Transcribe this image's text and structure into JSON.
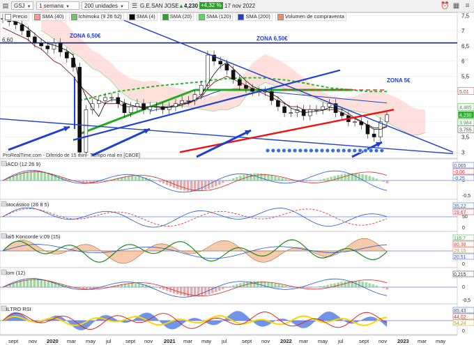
{
  "toolbar": {
    "symbol": "GSJ",
    "period": "1 semana",
    "units": "200 unidades",
    "instrument": "G.E.SAN JOSE",
    "last": "4,230",
    "change": "+4,32 %",
    "date": "17 nov 2022"
  },
  "legend": [
    {
      "label": "Precio",
      "color": "#ffffff"
    },
    {
      "label": "SMA (40)",
      "color": "#ff9999"
    },
    {
      "label": "Ichimoku (9 26 52)",
      "color": "#66cc66"
    },
    {
      "label": "SMA (4)",
      "color": "#000000"
    },
    {
      "label": "SMA (20)",
      "color": "#22aa22"
    },
    {
      "label": "SMA (120)",
      "color": "#55dd55"
    },
    {
      "label": "SMA (200)",
      "color": "#1f3fd0"
    },
    {
      "label": "Volumen de compraventa",
      "color": "#ff8c5a"
    }
  ],
  "annotations": {
    "zona_left": "ZONA 6,50€",
    "zona_right": "ZONA 6,50€",
    "zona_5": "ZONA 5€",
    "level_label": "6,60",
    "source": "ProRealTime.com - Diferido de 15 min - Tiempo real en [CBOE]"
  },
  "price_labels": [
    {
      "text": "5,01",
      "value": 5.01,
      "bg": "#ffffff",
      "fg": "#dd2222"
    },
    {
      "text": "4,485",
      "value": 4.485,
      "bg": "#ffffff",
      "fg": "#22aa22"
    },
    {
      "text": "4,230",
      "value": 4.23,
      "bg": "#33aa33",
      "fg": "#ffffff"
    },
    {
      "text": "3,984",
      "value": 3.984,
      "bg": "#ffffff",
      "fg": "#22aa22"
    },
    {
      "text": "3,755",
      "value": 3.755,
      "bg": "#ffffff",
      "fg": "#444444"
    }
  ],
  "chart_data": {
    "type": "line",
    "title": "G.E.SAN JOSE (GSJ) 1 semana",
    "y_ticks": [
      7.5,
      7,
      6.5,
      6,
      5.5,
      5,
      4.5,
      4,
      3.5,
      3
    ],
    "ylim": [
      2.8,
      7.6
    ],
    "x_ticks": [
      "sept",
      "nov",
      "2020",
      "mar",
      "may",
      "jul",
      "sept",
      "nov",
      "2021",
      "mar",
      "may",
      "jul",
      "sept",
      "nov",
      "2022",
      "mar",
      "may",
      "jul",
      "sept",
      "nov",
      "2023",
      "mar",
      "may"
    ],
    "series": [
      {
        "name": "Precio",
        "values": [
          7.4,
          7.3,
          7.2,
          7.0,
          6.8,
          6.6,
          6.5,
          6.4,
          6.6,
          6.3,
          6.1,
          5.8,
          3.0,
          4.4,
          4.6,
          4.7,
          4.8,
          4.8,
          4.6,
          4.3,
          4.5,
          4.6,
          4.4,
          4.5,
          4.5,
          4.4,
          4.5,
          4.6,
          4.7,
          4.7,
          4.9,
          5.2,
          6.2,
          6.0,
          5.9,
          5.7,
          5.4,
          5.2,
          5.1,
          5.0,
          5.0,
          5.0,
          4.7,
          4.5,
          4.3,
          4.3,
          4.4,
          4.2,
          4.4,
          4.4,
          4.5,
          4.6,
          4.3,
          4.2,
          4.0,
          4.0,
          3.9,
          3.6,
          3.5,
          4.0,
          4.23
        ]
      },
      {
        "name": "SMA (40)",
        "values": [
          7.1,
          7.0,
          6.9,
          6.8,
          6.7,
          6.5,
          6.4,
          6.2,
          6.0,
          5.9,
          5.7,
          5.5,
          5.2,
          5.0,
          4.8,
          4.7,
          4.6,
          4.6,
          4.6,
          4.5,
          4.5,
          4.5,
          4.5,
          4.5,
          4.5,
          4.5,
          4.5,
          4.5,
          4.6,
          4.6,
          4.7,
          4.8,
          5.1,
          5.3,
          5.4,
          5.5,
          5.4,
          5.3,
          5.2,
          5.1,
          5.0,
          4.9,
          4.8,
          4.7,
          4.6,
          4.5,
          4.5,
          4.4,
          4.4,
          4.4,
          4.4,
          4.4,
          4.4,
          4.3,
          4.2,
          4.1,
          4.0,
          3.9,
          3.8,
          3.8,
          3.85
        ]
      },
      {
        "name": "SMA (120)",
        "values": [
          null,
          null,
          null,
          null,
          null,
          null,
          null,
          null,
          null,
          null,
          null,
          null,
          4.7,
          4.75,
          4.8,
          4.85,
          4.9,
          4.95,
          5.0,
          5.03,
          5.06,
          5.09,
          5.12,
          5.15,
          5.18,
          5.2,
          5.22,
          5.24,
          5.26,
          5.28,
          5.3,
          5.32,
          5.35,
          5.38,
          5.4,
          5.42,
          5.43,
          5.44,
          5.45,
          5.45,
          5.45,
          5.44,
          5.42,
          5.4,
          5.38,
          5.35,
          5.32,
          5.28,
          5.24,
          5.2,
          5.16,
          5.12,
          5.1,
          5.08,
          5.06,
          5.04,
          5.02,
          5.0,
          5.0,
          5.0,
          5.0
        ]
      },
      {
        "name": "SMA (200)",
        "values": [
          null,
          null,
          null,
          null,
          null,
          null,
          null,
          null,
          null,
          null,
          null,
          null,
          null,
          null,
          null,
          null,
          null,
          null,
          null,
          null,
          null,
          null,
          null,
          4.35,
          4.4,
          4.45,
          4.5,
          4.55,
          4.6,
          4.65,
          4.72,
          4.8,
          4.88,
          4.96,
          5.02,
          5.06,
          5.08,
          5.08,
          5.06,
          5.04,
          5.02,
          5.0,
          4.98,
          4.96,
          4.94,
          4.92,
          4.9,
          4.88,
          4.86,
          4.84,
          4.82,
          4.8,
          4.78,
          4.76,
          4.74,
          4.72,
          4.7,
          4.68,
          4.66,
          4.64,
          4.62
        ]
      }
    ]
  },
  "panels": [
    {
      "name": "MACD (12 26 9)",
      "y_ticks": [
        "0,5",
        "0",
        "-0,5"
      ],
      "labels": [
        {
          "text": "0,065",
          "color": "#2255cc"
        },
        {
          "text": "-0,06",
          "color": "#dd2222"
        },
        {
          "text": "-0,25",
          "color": "#2255cc"
        }
      ]
    },
    {
      "name": "Estocástico (26 8 5)",
      "y_ticks": [
        "100",
        "50",
        "0"
      ],
      "labels": [
        {
          "text": "35,22",
          "color": "#2255cc"
        },
        {
          "text": "19,67",
          "color": "#dd2222"
        }
      ]
    },
    {
      "name": "Blai5 Koncorde v:09 (15)",
      "y_ticks": [
        "100",
        "50",
        "0"
      ],
      "labels": [
        {
          "text": "116,7",
          "color": "#22aa22"
        },
        {
          "text": "80,38",
          "color": "#dd4444"
        },
        {
          "text": "29,15",
          "color": "#cc8844"
        },
        {
          "text": "20,51",
          "color": "#2255cc"
        }
      ]
    },
    {
      "name": "Mom (12)",
      "y_ticks": [
        "0,5",
        "0",
        "-0,5"
      ],
      "labels": [
        {
          "text": "0,215",
          "color": "#222222"
        }
      ]
    },
    {
      "name": "FILTRO RSI",
      "y_ticks": [
        "100",
        "50",
        "0"
      ],
      "labels": [
        {
          "text": "85,43",
          "color": "#2255cc"
        },
        {
          "text": "44,02",
          "color": "#dd2222"
        },
        {
          "text": "54,24",
          "color": "#bba000"
        }
      ]
    }
  ]
}
